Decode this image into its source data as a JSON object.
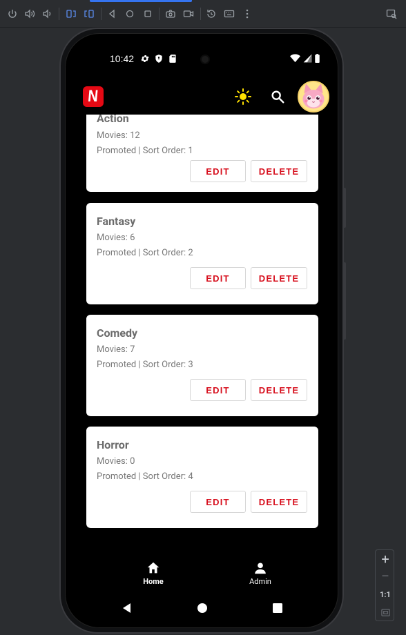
{
  "status": {
    "time": "10:42"
  },
  "app": {
    "logo_letter": "N",
    "nav": {
      "home": "Home",
      "admin": "Admin"
    }
  },
  "genres": [
    {
      "name": "Action",
      "movies": "Movies: 12",
      "meta": "Promoted | Sort Order: 1",
      "edit": "EDIT",
      "delete": "DELETE"
    },
    {
      "name": "Fantasy",
      "movies": "Movies: 6",
      "meta": "Promoted | Sort Order: 2",
      "edit": "EDIT",
      "delete": "DELETE"
    },
    {
      "name": "Comedy",
      "movies": "Movies: 7",
      "meta": "Promoted | Sort Order: 3",
      "edit": "EDIT",
      "delete": "DELETE"
    },
    {
      "name": "Horror",
      "movies": "Movies: 0",
      "meta": "Promoted | Sort Order: 4",
      "edit": "EDIT",
      "delete": "DELETE"
    }
  ],
  "emulator": {
    "zoom_label": "1:1"
  },
  "colors": {
    "accent": "#d7101e",
    "logo": "#e50914",
    "sun": "#ffe100"
  }
}
